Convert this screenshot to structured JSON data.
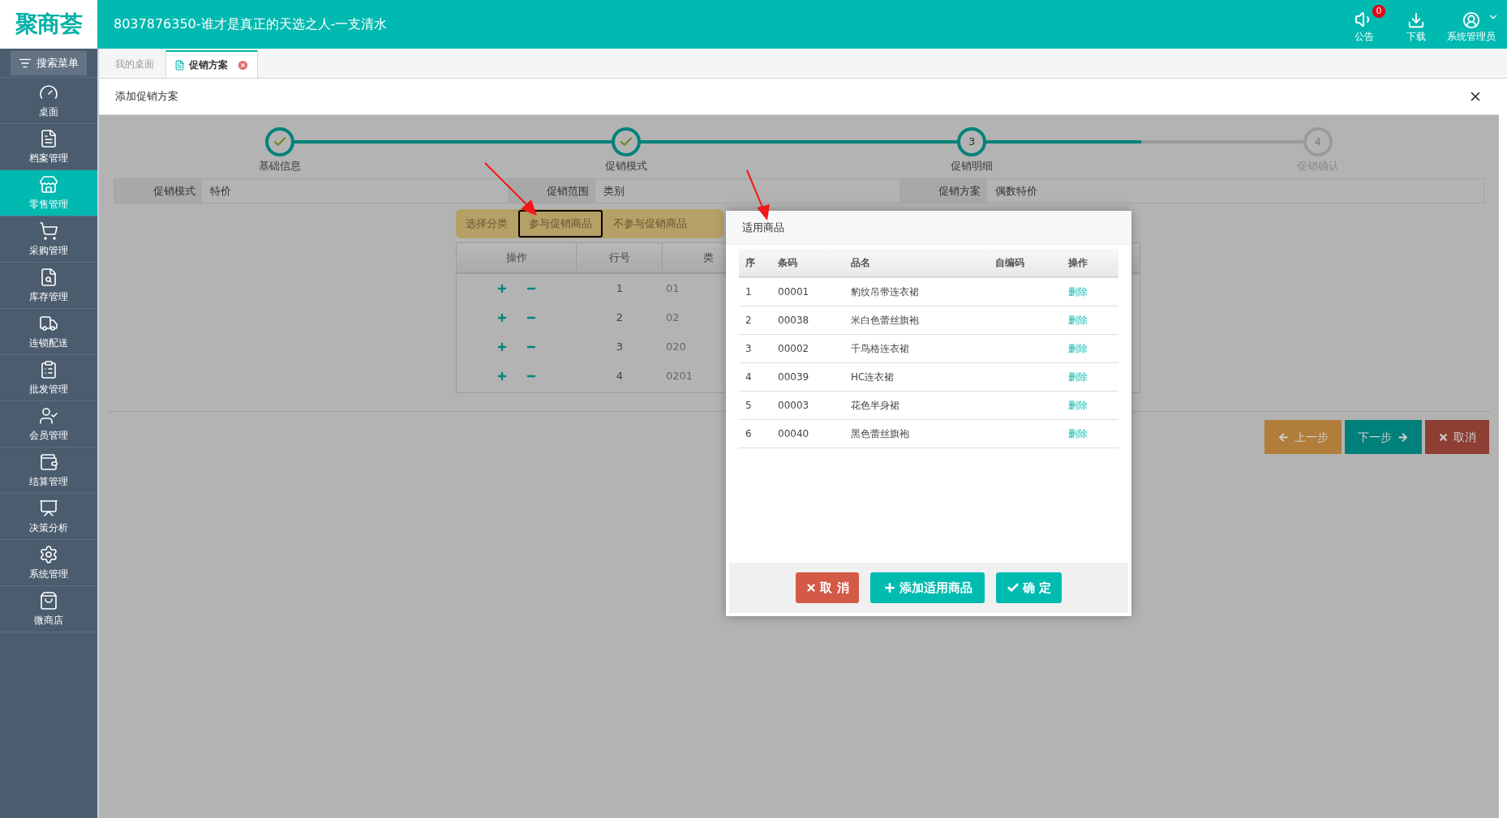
{
  "header": {
    "logo": "聚商荟",
    "title": "8037876350-谁才是真正的天选之人-一支清水",
    "notice": {
      "label": "公告",
      "badge": "0"
    },
    "download": {
      "label": "下载"
    },
    "user": {
      "label": "系统管理员"
    }
  },
  "sidebar": {
    "search": "搜索菜单",
    "items": [
      {
        "label": "桌面",
        "selected": false
      },
      {
        "label": "档案管理",
        "selected": false
      },
      {
        "label": "零售管理",
        "selected": true
      },
      {
        "label": "采购管理",
        "selected": false
      },
      {
        "label": "库存管理",
        "selected": false
      },
      {
        "label": "连锁配送",
        "selected": false
      },
      {
        "label": "批发管理",
        "selected": false
      },
      {
        "label": "会员管理",
        "selected": false
      },
      {
        "label": "结算管理",
        "selected": false
      },
      {
        "label": "决策分析",
        "selected": false
      },
      {
        "label": "系统管理",
        "selected": false
      },
      {
        "label": "微商店",
        "selected": false
      }
    ]
  },
  "tabs": [
    {
      "label": "我的桌面",
      "selected": false,
      "closable": false
    },
    {
      "label": "促销方案",
      "selected": true,
      "closable": true
    }
  ],
  "panel": {
    "title": "添加促销方案"
  },
  "stepper": {
    "level": 0.83,
    "steps": [
      {
        "label": "基础信息",
        "done": true,
        "current": false
      },
      {
        "label": "促销模式",
        "done": true,
        "current": false
      },
      {
        "label": "促销明细",
        "done": false,
        "current": true,
        "number": "3"
      },
      {
        "label": "促销确认",
        "done": false,
        "current": false,
        "number": "4"
      }
    ]
  },
  "info": [
    {
      "label": "促销模式",
      "value": "特价"
    },
    {
      "label": "促销范围",
      "value": "类别"
    },
    {
      "label": "促销方案",
      "value": "偶数特价"
    }
  ],
  "segments": [
    {
      "label": "选择分类",
      "selected": false
    },
    {
      "label": "参与促销商品",
      "selected": true
    },
    {
      "label": "不参与促销商品",
      "selected": false
    }
  ],
  "category_table": {
    "columns": [
      "操作",
      "行号",
      "类"
    ],
    "rows": [
      {
        "row_no": "1",
        "category": "01"
      },
      {
        "row_no": "2",
        "category": "02"
      },
      {
        "row_no": "3",
        "category": "020"
      },
      {
        "row_no": "4",
        "category": "0201"
      }
    ]
  },
  "nav_buttons": [
    {
      "kind": "prev",
      "label": "上一步"
    },
    {
      "kind": "next",
      "label": "下一步"
    },
    {
      "kind": "cancel",
      "label": "取消"
    }
  ],
  "modal": {
    "title": "适用商品",
    "columns": [
      "序",
      "条码",
      "品名",
      "自编码",
      "操作"
    ],
    "rows": [
      {
        "no": "1",
        "barcode": "00001",
        "name": "豹纹吊带连衣裙",
        "action": "删除"
      },
      {
        "no": "2",
        "barcode": "00038",
        "name": "米白色蕾丝旗袍",
        "action": "删除"
      },
      {
        "no": "3",
        "barcode": "00002",
        "name": "千鸟格连衣裙",
        "action": "删除"
      },
      {
        "no": "4",
        "barcode": "00039",
        "name": "HC连衣裙",
        "action": "删除"
      },
      {
        "no": "5",
        "barcode": "00003",
        "name": "花色半身裙",
        "action": "删除"
      },
      {
        "no": "6",
        "barcode": "00040",
        "name": "黑色蕾丝旗袍",
        "action": "删除"
      }
    ],
    "buttons": [
      {
        "kind": "cancel",
        "label": "取 消"
      },
      {
        "kind": "add",
        "label": "添加适用商品"
      },
      {
        "kind": "confirm",
        "label": "确 定"
      }
    ]
  }
}
